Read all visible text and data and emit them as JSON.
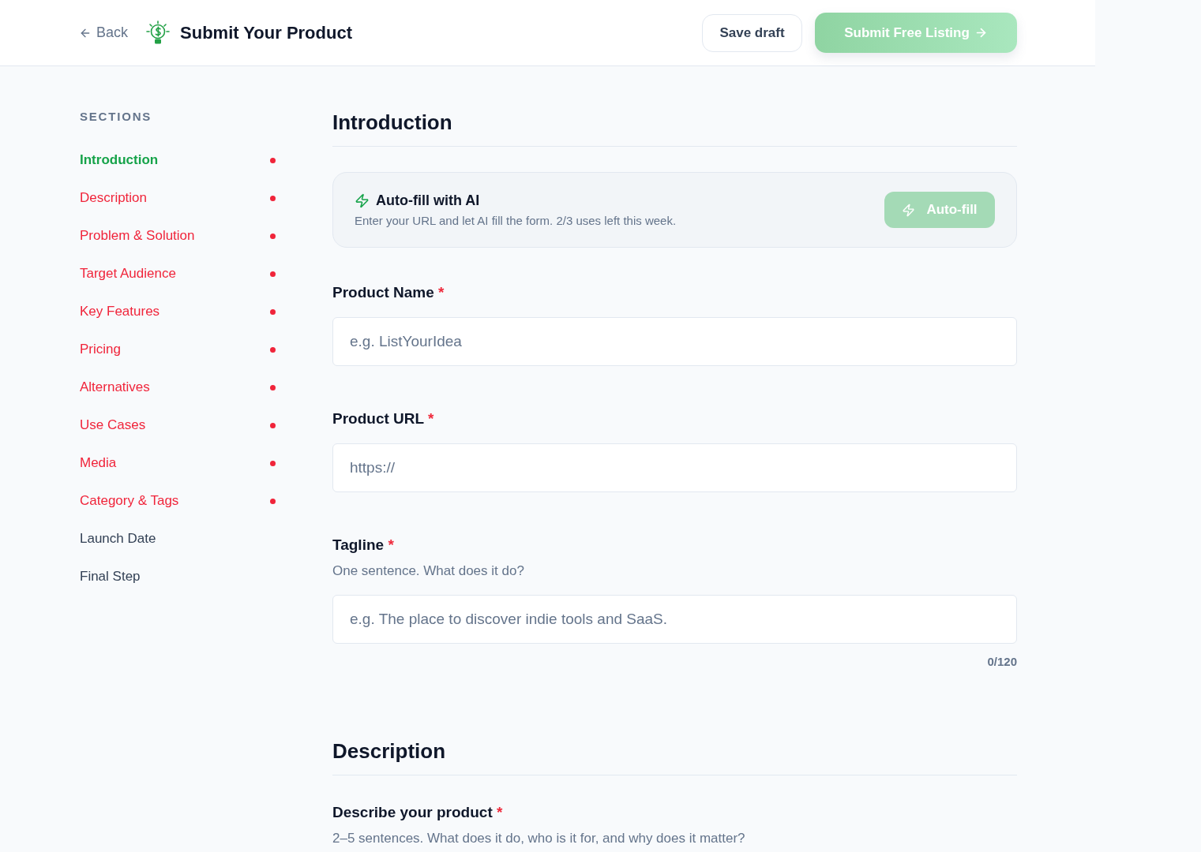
{
  "header": {
    "back_link": "Back",
    "title": "Submit Your Product",
    "save_button": {
      "label": "Save draft"
    },
    "submit_button": {
      "label": "Submit Free Listing",
      "disabled": true
    }
  },
  "sidebar": {
    "heading": "SECTIONS",
    "items": [
      {
        "label": "Introduction",
        "selected": true,
        "incomplete": true
      },
      {
        "label": "Description",
        "selected": false,
        "incomplete": true
      },
      {
        "label": "Problem & Solution",
        "selected": false,
        "incomplete": true
      },
      {
        "label": "Target Audience",
        "selected": false,
        "incomplete": true
      },
      {
        "label": "Key Features",
        "selected": false,
        "incomplete": true
      },
      {
        "label": "Pricing",
        "selected": false,
        "incomplete": true
      },
      {
        "label": "Alternatives",
        "selected": false,
        "incomplete": true
      },
      {
        "label": "Use Cases",
        "selected": false,
        "incomplete": true
      },
      {
        "label": "Media",
        "selected": false,
        "incomplete": true
      },
      {
        "label": "Category & Tags",
        "selected": false,
        "incomplete": true
      },
      {
        "label": "Launch Date",
        "selected": false,
        "incomplete": false
      },
      {
        "label": "Final Step",
        "selected": false,
        "incomplete": false
      }
    ]
  },
  "sections": [
    {
      "title": "Introduction",
      "ai_card": {
        "title": "Auto-fill with AI",
        "description": "Enter your URL and let AI fill the form. 2/3 uses left this week.",
        "button": {
          "label": "Auto-fill",
          "disabled": true
        }
      },
      "fields": [
        {
          "label": "Product Name",
          "required_mark": "*",
          "input": {
            "placeholder": "e.g. ListYourIdea"
          }
        },
        {
          "label": "Product URL",
          "required_mark": "*",
          "input": {
            "placeholder": "https://"
          }
        },
        {
          "label": "Tagline",
          "required_mark": "*",
          "hint": "One sentence. What does it do?",
          "input": {
            "placeholder": "e.g. The place to discover indie tools and SaaS."
          },
          "counter": "0/120"
        }
      ]
    },
    {
      "title": "Description",
      "fields": [
        {
          "label": "Describe your product",
          "required_mark": "*",
          "hint": "2–5 sentences. What does it do, who is it for, and why does it matter?"
        }
      ]
    }
  ]
}
